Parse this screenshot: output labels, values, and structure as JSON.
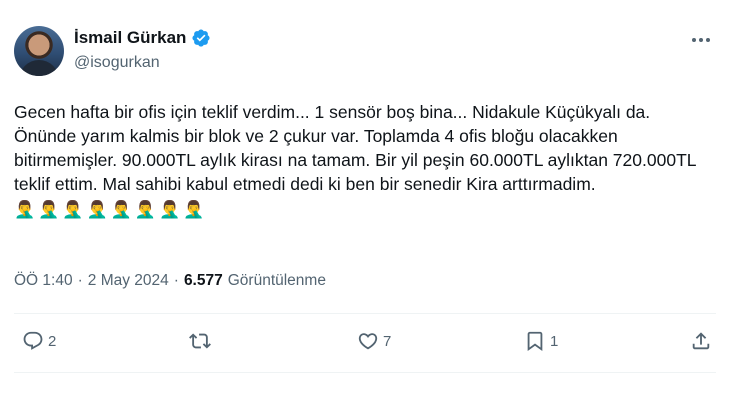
{
  "author": {
    "name": "İsmail Gürkan",
    "handle": "@isogurkan",
    "verified": true
  },
  "tweet": {
    "text": "Gecen hafta bir ofis için teklif verdim... 1 sensör boş bina... Nidakule Küçükyalı da. Önünde yarım kalmis bir blok ve 2 çukur var. Toplamda 4 ofis bloğu olacakken bitirmemişler. 90.000TL aylık kirası na tamam. Bir yil peşin 60.000TL aylıktan 720.000TL teklif ettim. Mal sahibi kabul etmedi dedi ki ben bir senedir Kira arttırmadim.",
    "emojis": "🤦‍♂️🤦‍♂️🤦‍♂️🤦‍♂️🤦‍♂️🤦‍♂️🤦‍♂️🤦‍♂️"
  },
  "meta": {
    "time": "ÖÖ 1:40",
    "date": "2 May 2024",
    "separator": "·",
    "views_count": "6.577",
    "views_label": "Görüntülenme"
  },
  "actions": {
    "reply_count": "2",
    "retweet_count": "",
    "like_count": "7",
    "bookmark_count": "1"
  },
  "colors": {
    "text": "#0f1419",
    "secondary": "#536471",
    "verified": "#1d9bf0",
    "divider": "#eff3f4"
  },
  "icons": [
    "more-icon",
    "verified-badge-icon",
    "reply-icon",
    "retweet-icon",
    "like-icon",
    "bookmark-icon",
    "share-icon"
  ]
}
